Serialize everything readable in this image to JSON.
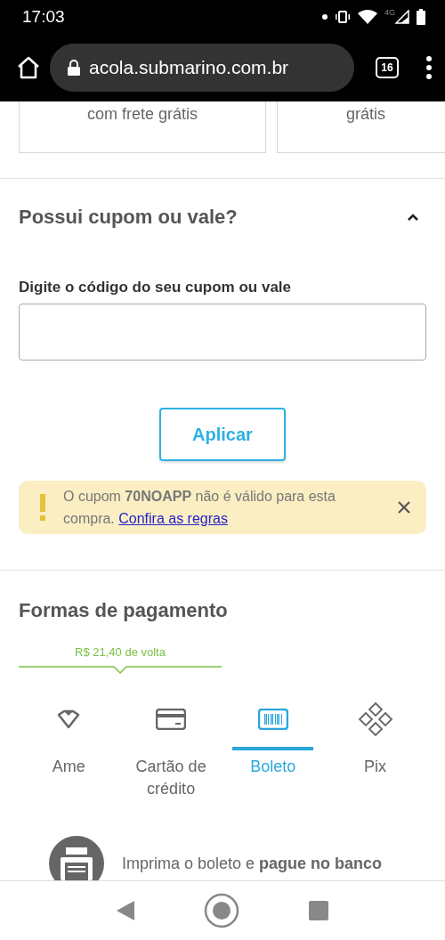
{
  "status_bar": {
    "time": "17:03",
    "network": "4G"
  },
  "browser": {
    "url": "acola.submarino.com.br",
    "tab_count": "16"
  },
  "delivery_cards": [
    {
      "text": "com frete grátis"
    },
    {
      "text": "grátis"
    }
  ],
  "coupon": {
    "title": "Possui cupom ou vale?",
    "expanded": true,
    "field_label": "Digite o código do seu cupom ou vale",
    "button": "Aplicar",
    "alert": {
      "message": "O cupom **70NOAPP** não é válido para esta compra.",
      "link": "Confira as regras"
    }
  },
  "payment": {
    "title": "Formas de pagamento",
    "cashback": "R$ 21,40 de volta",
    "methods": [
      {
        "kind": "ame",
        "label": "Ame",
        "selected": false
      },
      {
        "kind": "card",
        "label": "Cartão de crédito",
        "selected": false
      },
      {
        "kind": "boleto",
        "label": "Boleto",
        "selected": true
      },
      {
        "kind": "pix",
        "label": "Pix",
        "selected": false
      }
    ],
    "boleto_info": "Imprima o boleto e **pague no banco**"
  }
}
